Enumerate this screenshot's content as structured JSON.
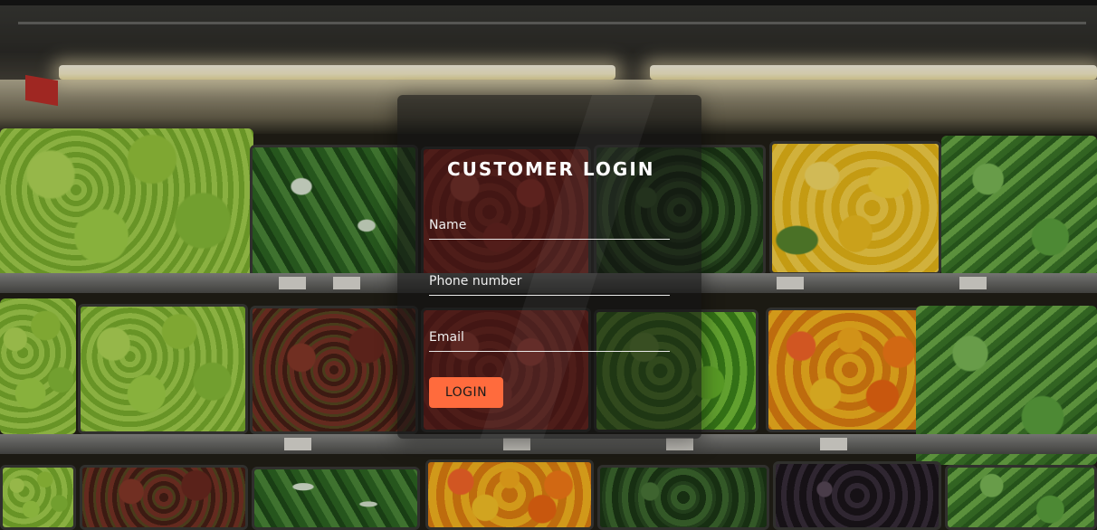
{
  "login": {
    "title": "CUSTOMER LOGIN",
    "fields": {
      "name_placeholder": "Name",
      "phone_placeholder": "Phone number",
      "email_placeholder": "Email"
    },
    "button_label": "LOGIN"
  },
  "colors": {
    "button_bg": "#ff6b3d",
    "panel_bg": "rgba(20,20,20,0.62)",
    "field_underline": "#e8e8e8"
  }
}
